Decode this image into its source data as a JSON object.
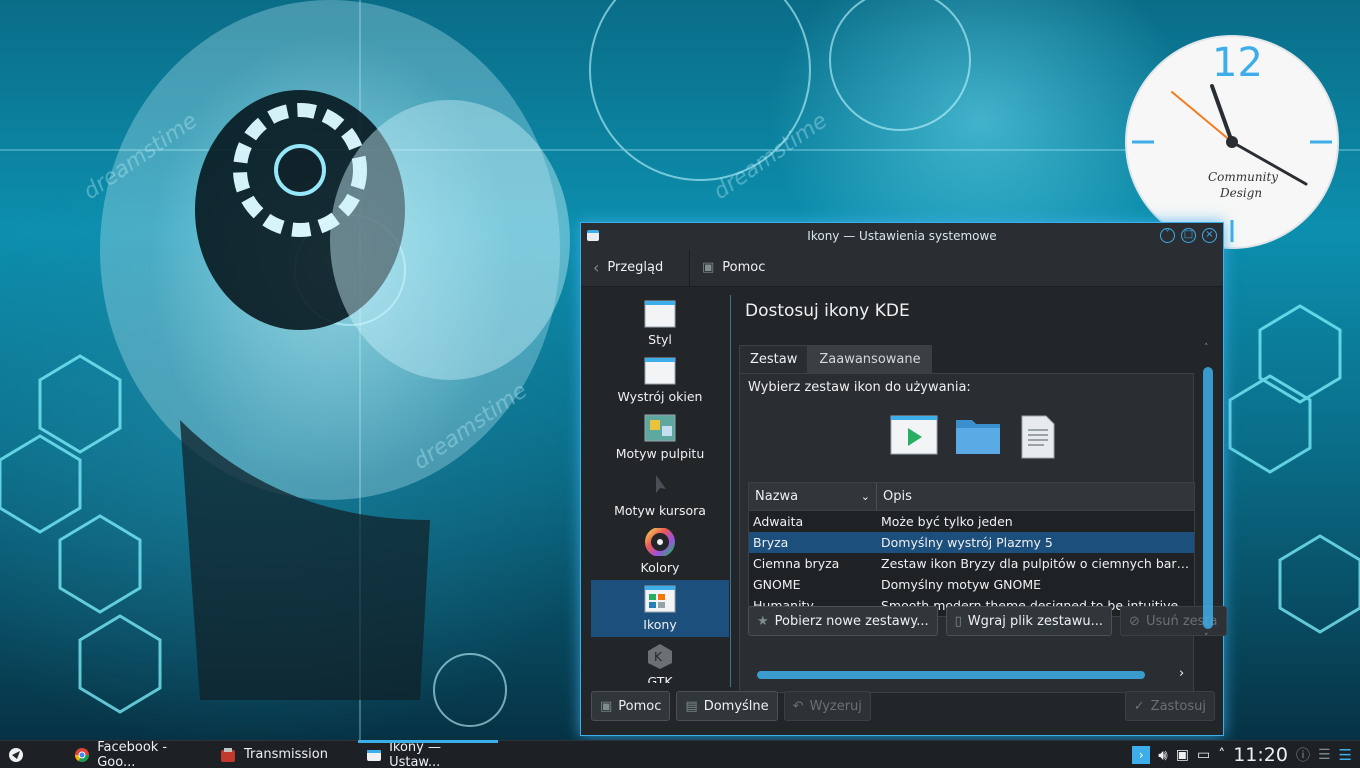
{
  "clock_widget": {
    "hour_label": "12",
    "brand_line1": "Community",
    "brand_line2": "Design"
  },
  "window": {
    "title": "Ikony  — Ustawienia systemowe",
    "toolbar": {
      "overview_label": "Przegląd",
      "help_label": "Pomoc"
    },
    "sidebar": {
      "items": [
        {
          "label": "Styl",
          "icon": "window-icon"
        },
        {
          "label": "Wystrój okien",
          "icon": "window-icon"
        },
        {
          "label": "Motyw pulpitu",
          "icon": "desktop-theme-icon"
        },
        {
          "label": "Motyw kursora",
          "icon": "cursor-icon"
        },
        {
          "label": "Kolory",
          "icon": "color-wheel-icon"
        },
        {
          "label": "Ikony",
          "icon": "icons-icon",
          "active": true
        },
        {
          "label": "GTK",
          "icon": "gtk-icon"
        }
      ]
    },
    "content": {
      "title": "Dostosuj ikony KDE",
      "tabs": [
        "Zestaw",
        "Zaawansowane"
      ],
      "hint": "Wybierz zestaw ikon do używania:",
      "preview_icons": [
        "media-player-icon",
        "folder-icon",
        "text-file-icon"
      ],
      "table": {
        "columns": [
          "Nazwa",
          "Opis"
        ],
        "rows": [
          {
            "name": "Adwaita",
            "desc": "Może być tylko jeden"
          },
          {
            "name": "Bryza",
            "desc": "Domyślny wystrój Plazmy 5",
            "selected": true
          },
          {
            "name": "Ciemna bryza",
            "desc": "Zestaw ikon Bryzy dla pulpitów o ciemnych barwa..."
          },
          {
            "name": "GNOME",
            "desc": "Domyślny motyw GNOME"
          },
          {
            "name": "Humanity",
            "desc": "Smooth modern theme designed to be intuitive."
          }
        ]
      },
      "buttons": {
        "get_new": "Pobierz nowe zestawy...",
        "install_file": "Wgraj plik zestawu...",
        "remove": "Usuń zesta"
      }
    },
    "footer": {
      "help": "Pomoc",
      "defaults": "Domyślne",
      "reset": "Wyzeruj",
      "apply": "Zastosuj"
    }
  },
  "taskbar": {
    "tasks": [
      {
        "label": "Facebook - Goo...",
        "icon": "chrome-icon"
      },
      {
        "label": "Transmission",
        "icon": "transmission-icon"
      },
      {
        "label": "Ikony  — Ustaw...",
        "icon": "settings-icon",
        "active": true
      }
    ],
    "clock": "11:20"
  },
  "colors": {
    "accent": "#3daee9",
    "selection": "#1d4f7c",
    "window_bg": "#232629"
  }
}
